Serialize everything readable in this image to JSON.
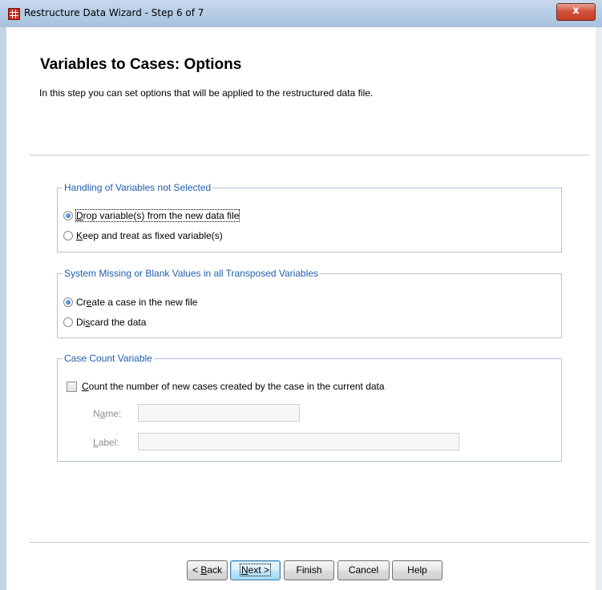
{
  "window": {
    "title": "Restructure Data Wizard - Step 6 of 7",
    "close_glyph": "x"
  },
  "page": {
    "heading": "Variables to Cases: Options",
    "subtitle": "In this step you can set options that will be applied to the restructured data file."
  },
  "handling": {
    "legend": "Handling of Variables not Selected",
    "drop": {
      "mnemonic": "D",
      "rest": "rop variable(s) from the new data file",
      "selected": true
    },
    "keep": {
      "mnemonic": "K",
      "rest": "eep and treat as fixed variable(s)",
      "selected": false
    }
  },
  "missing": {
    "legend": "System Missing or Blank Values in all Transposed Variables",
    "create": {
      "pre": "Cr",
      "mnemonic": "e",
      "rest": "ate a case in the new file",
      "selected": true
    },
    "discard": {
      "pre": "Di",
      "mnemonic": "s",
      "rest": "card the data",
      "selected": false
    }
  },
  "case_count": {
    "legend": "Case Count Variable",
    "checkbox": {
      "mnemonic": "C",
      "rest": "ount the number of new cases created by the case in the current data",
      "checked": false
    },
    "name": {
      "pre": "N",
      "mnemonic": "a",
      "rest": "me:",
      "value": ""
    },
    "label": {
      "mnemonic": "L",
      "rest": "abel:",
      "value": ""
    }
  },
  "buttons": {
    "back": {
      "pre": "< ",
      "mnemonic": "B",
      "rest": "ack"
    },
    "next": {
      "mnemonic": "N",
      "rest": "ext >"
    },
    "finish": "Finish",
    "cancel": "Cancel",
    "help": "Help"
  }
}
